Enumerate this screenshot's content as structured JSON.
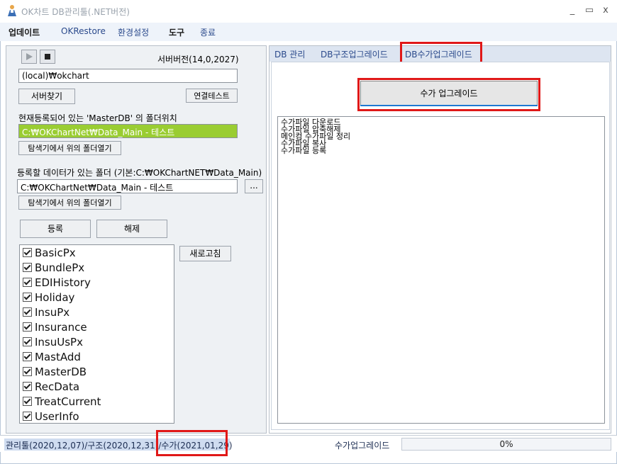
{
  "window": {
    "title": "OK차트 DB관리툴(.NET버전)",
    "minimize": "_",
    "maximize": "▭",
    "close": "x"
  },
  "menu": [
    "업데이트",
    "OKRestore",
    "환경설정",
    "도구",
    "종료"
  ],
  "left": {
    "server_version": "서버버전(14,0,2027)",
    "server_name": "(local)₩okchart",
    "find_server_button": "서버찾기",
    "test_connection_button": "연결테스트",
    "masterdb_label": "현재등록되어 있는 'MasterDB' 의 폴더위치",
    "masterdb_path": "C:₩OKChartNet₩Data_Main - 테스트",
    "open_explorer_button": "탐색기에서 위의 폴더열기",
    "data_folder_label": "등록할 데이터가 있는 폴더 (기본:C:₩OKChartNET₩Data_Main)",
    "data_folder_path": "C:₩OKChartNet₩Data_Main - 테스트",
    "browse_button": "...",
    "open_explorer_button2": "탐색기에서 위의 폴더열기",
    "register_button": "등록",
    "unregister_button": "해제",
    "refresh_button": "새로고침",
    "databases": [
      "BasicPx",
      "BundlePx",
      "EDIHistory",
      "Holiday",
      "InsuPx",
      "Insurance",
      "InsuUsPx",
      "MastAdd",
      "MasterDB",
      "RecData",
      "TreatCurrent",
      "UserInfo"
    ]
  },
  "tabs": [
    "DB 관리",
    "DB구조업그레이드",
    "DB수가업그레이드"
  ],
  "right": {
    "upgrade_button": "수가 업그레이드",
    "log_lines": [
      "수가파일 다운로드",
      "수가파일 압축해제",
      "메인컴 수가파일 정리",
      "수가파일 복사",
      "수가파일 등록"
    ]
  },
  "status": {
    "left_text": "관리툴(2020,12,07)/구조(2020,12,31)/수가(2021,01,29)",
    "task_label": "수가업그레이드",
    "progress_text": "0%",
    "progress_value": 0
  },
  "colors": {
    "highlight_path_bg": "#9acd32",
    "annotation_red": "#e01818",
    "accent_blue": "#1f78d1"
  }
}
